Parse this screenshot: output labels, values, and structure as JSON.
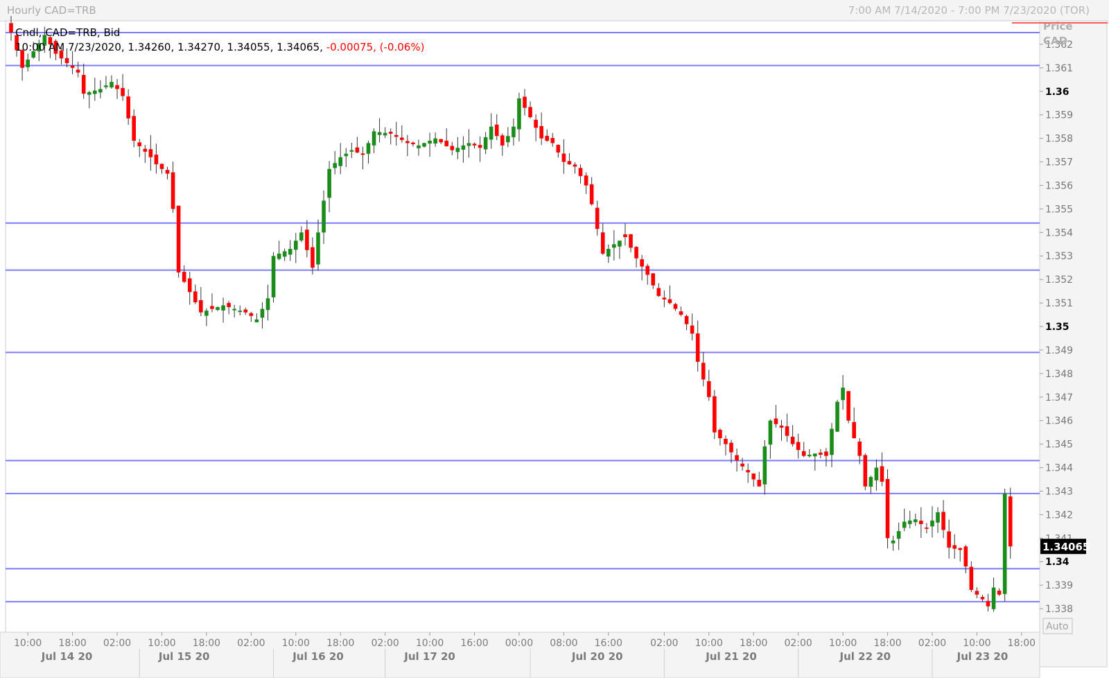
{
  "title_left": "Hourly CAD=TRB",
  "title_right": "7:00 AM 7/14/2020 - 7:00 PM 7/23/2020 (TOR)",
  "legend": {
    "line1": "Cndl, CAD=TRB, Bid",
    "line2": "10:00 AM 7/23/2020, 1.34260, 1.34270, 1.34055, 1.34065,",
    "change": "-0.00075, (-0.06%)"
  },
  "price_axis": {
    "header1": "Price",
    "header2": "CAD",
    "auto_label": "Auto"
  },
  "last_price_label": "1.34065",
  "colors": {
    "up": "#1a8c1a",
    "down": "#ff0000",
    "level_line": "#7b7bff"
  },
  "chart_data": {
    "type": "candlestick",
    "series_name": "Cndl, CAD=TRB, Bid",
    "ylim": [
      1.337,
      1.363
    ],
    "y_ticks": [
      1.338,
      1.339,
      1.34,
      1.341,
      1.342,
      1.343,
      1.344,
      1.345,
      1.346,
      1.347,
      1.348,
      1.349,
      1.35,
      1.351,
      1.352,
      1.353,
      1.354,
      1.355,
      1.356,
      1.357,
      1.358,
      1.359,
      1.36,
      1.361,
      1.362
    ],
    "y_tick_labels": [
      "1.338",
      "1.339",
      "1.34",
      "1.341",
      "1.342",
      "1.343",
      "1.344",
      "1.345",
      "1.346",
      "1.347",
      "1.348",
      "1.349",
      "1.35",
      "1.351",
      "1.352",
      "1.353",
      "1.354",
      "1.355",
      "1.356",
      "1.357",
      "1.358",
      "1.359",
      "1.36",
      "1.361",
      "1.362"
    ],
    "bold_ticks": [
      1.34,
      1.35,
      1.36
    ],
    "horizontal_levels": [
      1.3625,
      1.3611,
      1.3544,
      1.3524,
      1.3489,
      1.3443,
      1.3429,
      1.3397,
      1.3383
    ],
    "last_price": 1.34065,
    "time_ticks": [
      {
        "bar": 3,
        "label": "10:00"
      },
      {
        "bar": 11,
        "label": "18:00"
      },
      {
        "bar": 19,
        "label": "02:00"
      },
      {
        "bar": 27,
        "label": "10:00"
      },
      {
        "bar": 35,
        "label": "18:00"
      },
      {
        "bar": 43,
        "label": "02:00"
      },
      {
        "bar": 51,
        "label": "10:00"
      },
      {
        "bar": 59,
        "label": "18:00"
      },
      {
        "bar": 67,
        "label": "02:00"
      },
      {
        "bar": 75,
        "label": "10:00"
      },
      {
        "bar": 83,
        "label": "16:00"
      },
      {
        "bar": 91,
        "label": "00:00"
      },
      {
        "bar": 99,
        "label": "08:00"
      },
      {
        "bar": 107,
        "label": "16:00"
      },
      {
        "bar": 117,
        "label": "02:00"
      },
      {
        "bar": 125,
        "label": "10:00"
      },
      {
        "bar": 133,
        "label": "18:00"
      },
      {
        "bar": 141,
        "label": "02:00"
      },
      {
        "bar": 149,
        "label": "10:00"
      },
      {
        "bar": 157,
        "label": "18:00"
      },
      {
        "bar": 165,
        "label": "02:00"
      },
      {
        "bar": 173,
        "label": "10:00"
      },
      {
        "bar": 181,
        "label": "18:00"
      }
    ],
    "day_labels": [
      {
        "bar": 10,
        "label": "Jul 14 20"
      },
      {
        "bar": 31,
        "label": "Jul 15 20"
      },
      {
        "bar": 55,
        "label": "Jul 16 20"
      },
      {
        "bar": 75,
        "label": "Jul 17 20"
      },
      {
        "bar": 105,
        "label": "Jul 20 20"
      },
      {
        "bar": 129,
        "label": "Jul 21 20"
      },
      {
        "bar": 153,
        "label": "Jul 22 20"
      },
      {
        "bar": 174,
        "label": "Jul 23 20"
      }
    ],
    "day_separators": [
      23,
      47,
      67,
      93,
      117,
      141,
      165
    ],
    "close_path": [
      [
        0,
        1.3625
      ],
      [
        2,
        1.361
      ],
      [
        6,
        1.3624
      ],
      [
        8,
        1.3616
      ],
      [
        12,
        1.3608
      ],
      [
        13,
        1.3599
      ],
      [
        16,
        1.3601
      ],
      [
        18,
        1.3604
      ],
      [
        20,
        1.3598
      ],
      [
        22,
        1.3579
      ],
      [
        25,
        1.3572
      ],
      [
        26,
        1.3569
      ],
      [
        28,
        1.3565
      ],
      [
        29,
        1.355
      ],
      [
        30,
        1.3523
      ],
      [
        31,
        1.3519
      ],
      [
        34,
        1.3506
      ],
      [
        38,
        1.3509
      ],
      [
        42,
        1.3506
      ],
      [
        44,
        1.3503
      ],
      [
        46,
        1.3512
      ],
      [
        47,
        1.353
      ],
      [
        50,
        1.3533
      ],
      [
        52,
        1.354
      ],
      [
        54,
        1.3525
      ],
      [
        55,
        1.354
      ],
      [
        57,
        1.3567
      ],
      [
        59,
        1.3572
      ],
      [
        61,
        1.3575
      ],
      [
        63,
        1.3573
      ],
      [
        65,
        1.3583
      ],
      [
        68,
        1.3582
      ],
      [
        71,
        1.3578
      ],
      [
        73,
        1.3577
      ],
      [
        76,
        1.358
      ],
      [
        79,
        1.3575
      ],
      [
        82,
        1.3578
      ],
      [
        84,
        1.3576
      ],
      [
        86,
        1.3585
      ],
      [
        88,
        1.3577
      ],
      [
        90,
        1.3585
      ],
      [
        91,
        1.3597
      ],
      [
        93,
        1.3589
      ],
      [
        95,
        1.358
      ],
      [
        97,
        1.3578
      ],
      [
        99,
        1.357
      ],
      [
        101,
        1.3568
      ],
      [
        103,
        1.356
      ],
      [
        104,
        1.3552
      ],
      [
        106,
        1.3531
      ],
      [
        108,
        1.3535
      ],
      [
        110,
        1.3538
      ],
      [
        112,
        1.3529
      ],
      [
        114,
        1.3522
      ],
      [
        116,
        1.3513
      ],
      [
        118,
        1.351
      ],
      [
        120,
        1.3505
      ],
      [
        122,
        1.3497
      ],
      [
        123,
        1.3485
      ],
      [
        125,
        1.347
      ],
      [
        126,
        1.3455
      ],
      [
        128,
        1.345
      ],
      [
        130,
        1.3443
      ],
      [
        132,
        1.3438
      ],
      [
        134,
        1.3432
      ],
      [
        135,
        1.3449
      ],
      [
        136,
        1.346
      ],
      [
        138,
        1.3457
      ],
      [
        140,
        1.345
      ],
      [
        142,
        1.3445
      ],
      [
        144,
        1.3446
      ],
      [
        146,
        1.3445
      ],
      [
        148,
        1.3468
      ],
      [
        149,
        1.3474
      ],
      [
        150,
        1.346
      ],
      [
        152,
        1.3445
      ],
      [
        153,
        1.3432
      ],
      [
        155,
        1.344
      ],
      [
        156,
        1.3434
      ],
      [
        157,
        1.341
      ],
      [
        158,
        1.3409
      ],
      [
        160,
        1.3417
      ],
      [
        162,
        1.3418
      ],
      [
        164,
        1.3414
      ],
      [
        166,
        1.3421
      ],
      [
        168,
        1.3406
      ],
      [
        170,
        1.3405
      ],
      [
        171,
        1.3398
      ],
      [
        172,
        1.3388
      ],
      [
        174,
        1.3384
      ],
      [
        175,
        1.3381
      ],
      [
        176,
        1.3389
      ],
      [
        177,
        1.3386
      ],
      [
        178,
        1.3429
      ],
      [
        179,
        1.34065
      ]
    ],
    "swing_seed": 0.00062
  }
}
